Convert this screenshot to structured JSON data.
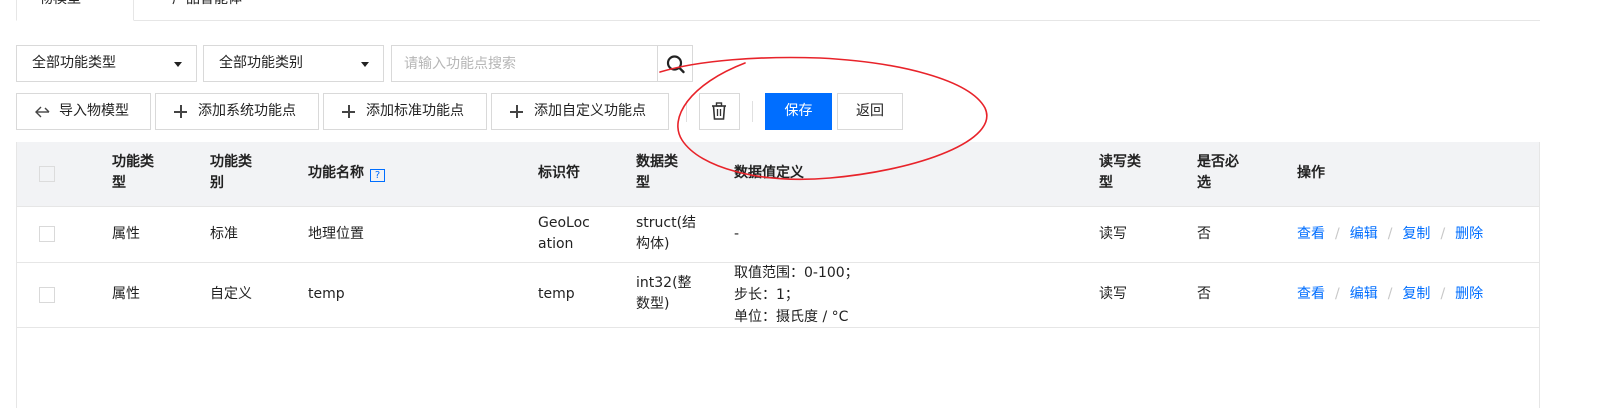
{
  "top_tabs": [
    {
      "label": "物模型",
      "active": true
    },
    {
      "label": "产品智能体",
      "active": false
    }
  ],
  "filters": {
    "type_select": "全部功能类型",
    "category_select": "全部功能类别",
    "search_placeholder": "请输入功能点搜索"
  },
  "toolbar": {
    "import_label": "导入物模型",
    "add_system_label": "添加系统功能点",
    "add_standard_label": "添加标准功能点",
    "add_custom_label": "添加自定义功能点",
    "save_label": "保存",
    "back_label": "返回"
  },
  "table": {
    "headers": {
      "func_type": "功能类型",
      "func_category": "功能类别",
      "func_name": "功能名称",
      "identifier": "标识符",
      "data_type": "数据类型",
      "data_def": "数据值定义",
      "rw_type": "读写类型",
      "required": "是否必选",
      "ops": "操作"
    },
    "help_icon_glyph": "?",
    "rows": [
      {
        "func_type": "属性",
        "func_category": "标准",
        "func_name": "地理位置",
        "identifier": "GeoLocation",
        "data_type": "struct(结构体)",
        "data_def": [
          "-"
        ],
        "rw_type": "读写",
        "required": "否",
        "ops": [
          "查看",
          "编辑",
          "复制",
          "删除"
        ]
      },
      {
        "func_type": "属性",
        "func_category": "自定义",
        "func_name": "temp",
        "identifier": "temp",
        "data_type": "int32(整数型)",
        "data_def": [
          "取值范围：0-100；",
          "步长：1；",
          "单位：摄氏度 / °C"
        ],
        "rw_type": "读写",
        "required": "否",
        "ops": [
          "查看",
          "编辑",
          "复制",
          "删除"
        ]
      }
    ]
  },
  "colors": {
    "primary": "#006eff",
    "annotation": "#e8232a",
    "header_bg": "#f2f3f5"
  },
  "icons": [
    "import-icon",
    "plus-icon",
    "trash-icon",
    "search-icon",
    "chevron-down-icon",
    "help-icon"
  ]
}
